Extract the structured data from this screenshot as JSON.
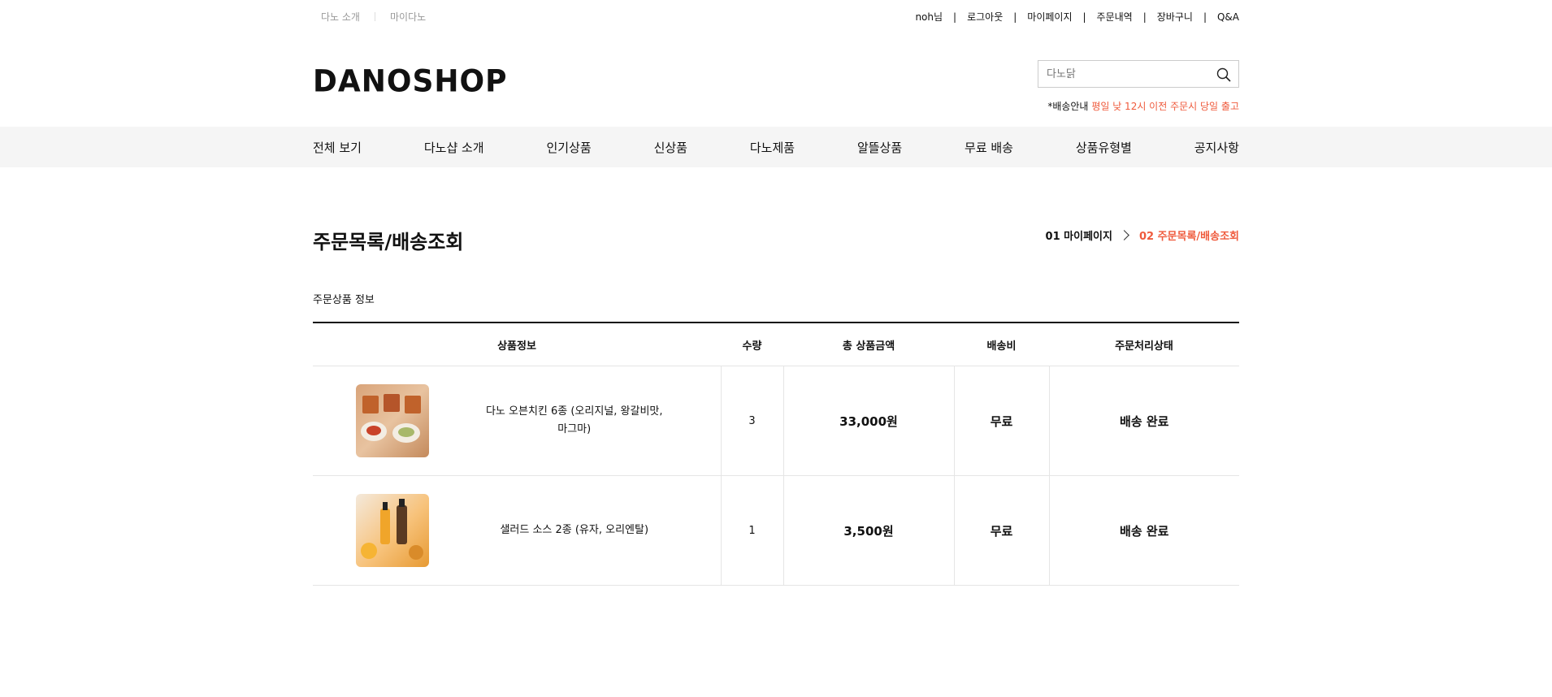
{
  "util": {
    "left": [
      "다노 소개",
      "마이다노"
    ],
    "right": [
      "noh님",
      "로그아웃",
      "마이페이지",
      "주문내역",
      "장바구니",
      "Q&A"
    ],
    "separator": "|"
  },
  "header": {
    "logo": "DANOSHOP",
    "search_placeholder": "다노닭",
    "notice_prefix": "*배송안내",
    "notice_highlight": "평일 낮 12시 이전 주문시 당일 출고"
  },
  "nav": [
    "전체 보기",
    "다노샵 소개",
    "인기상품",
    "신상품",
    "다노제품",
    "알뜰상품",
    "무료 배송",
    "상품유형별",
    "공지사항"
  ],
  "page": {
    "title": "주문목록/배송조회",
    "breadcrumb": [
      "01 마이페이지",
      "02 주문목록/배송조회"
    ],
    "section_label": "주문상품 정보"
  },
  "table": {
    "headers": [
      "상품정보",
      "수량",
      "총 상품금액",
      "배송비",
      "주문처리상태"
    ],
    "rows": [
      {
        "name_line1": "다노 오븐치킨 6종 (오리지널, 왕갈비맛,",
        "name_line2": "마그마)",
        "qty": "3",
        "price": "33,000원",
        "shipping": "무료",
        "status": "배송 완료"
      },
      {
        "name_line1": "샐러드 소스 2종 (유자, 오리엔탈)",
        "name_line2": "",
        "qty": "1",
        "price": "3,500원",
        "shipping": "무료",
        "status": "배송 완료"
      }
    ]
  },
  "colors": {
    "accent": "#ef5a3c",
    "nav_bg": "#f5f5f5"
  }
}
